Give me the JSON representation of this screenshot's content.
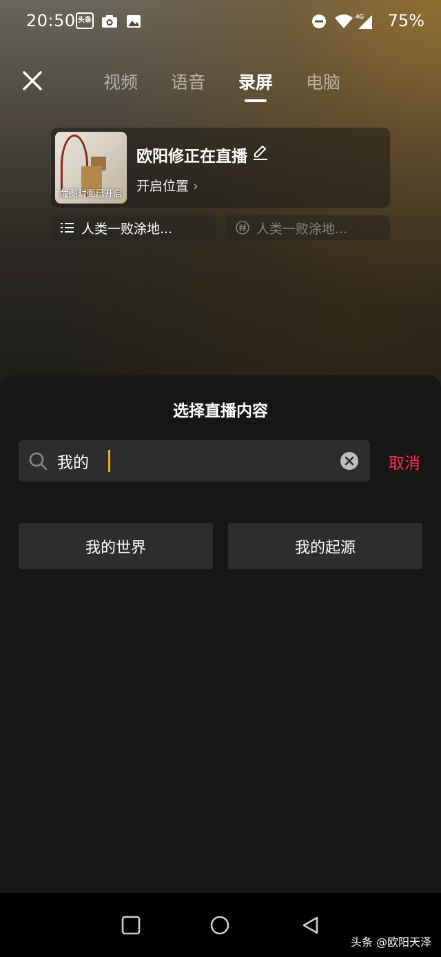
{
  "status_bar": {
    "time": "20:50",
    "app_badge": "头条",
    "network": "4G",
    "battery": "75%"
  },
  "tabs": [
    {
      "label": "视频",
      "active": false
    },
    {
      "label": "语音",
      "active": false
    },
    {
      "label": "录屏",
      "active": true
    },
    {
      "label": "电脑",
      "active": false
    }
  ],
  "live_card": {
    "title": "欧阳修正在直播",
    "cover_label": "截图封面已开启",
    "location_label": "开启位置"
  },
  "chips": {
    "category": "人类一败涂地...",
    "topic_placeholder": "人类一败涂地..."
  },
  "sheet": {
    "title": "选择直播内容",
    "search_value": "我的",
    "cancel_label": "取消",
    "results": [
      "我的世界",
      "我的起源"
    ]
  },
  "watermark": "头条 @欧阳天泽",
  "colors": {
    "accent": "#fe2c55",
    "caret": "#f5a623",
    "sheet_bg": "#161616",
    "field_bg": "#2d2d2d"
  }
}
